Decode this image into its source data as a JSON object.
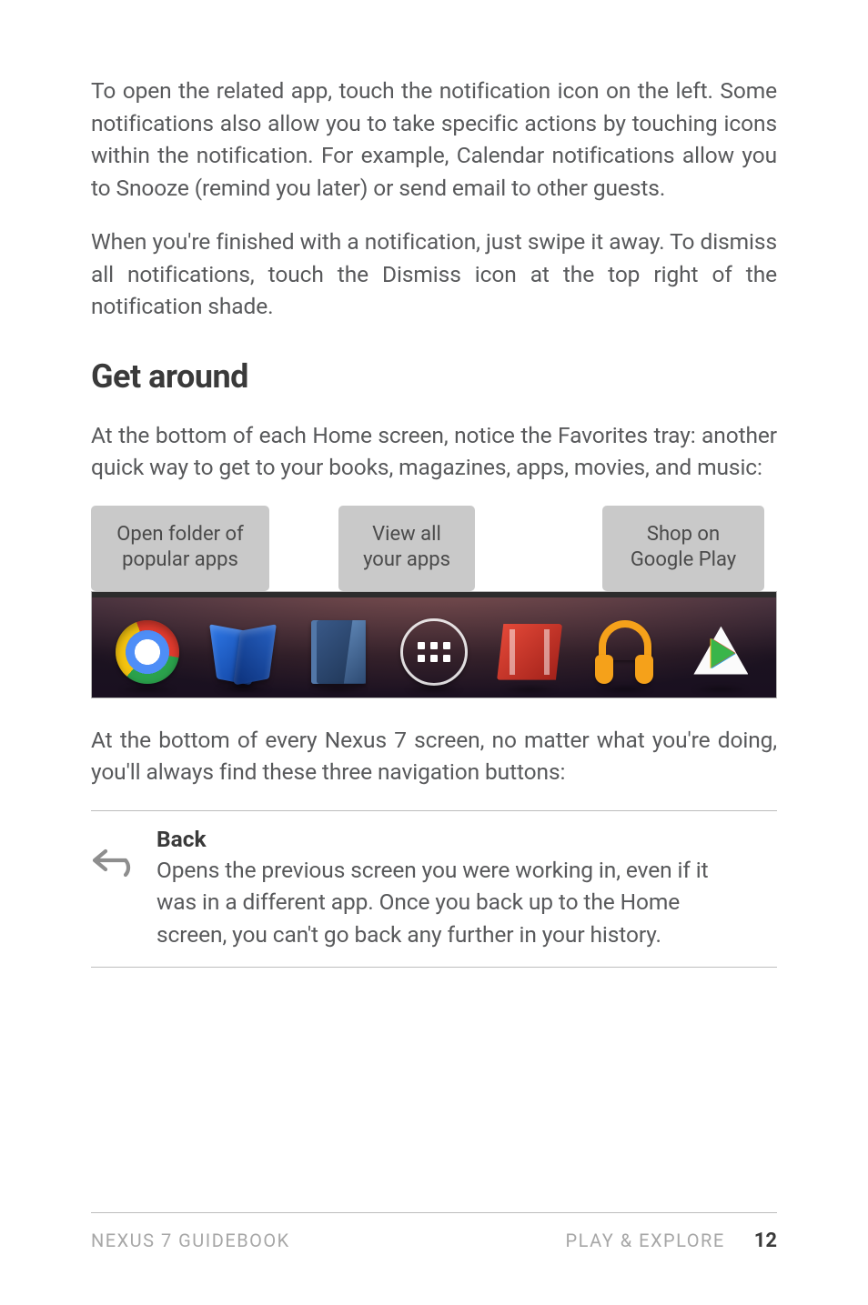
{
  "paragraphs": {
    "p1": "To open the related app, touch the notification icon on the left. Some notifications also allow you to take specific actions by touching icons within the notification. For example, Calendar notifications allow you to Snooze (remind you later) or send email to other guests.",
    "p2": "When you're finished with a notification, just swipe it away. To dismiss all notifications, touch the Dismiss icon at the top right of the notification shade.",
    "p3": "At the bottom of each Home screen, notice the Favorites tray: another quick way to get to your books, magazines, apps, movies, and music:",
    "p4": "At the bottom of every Nexus 7 screen, no matter what you're doing, you'll always find these three navigation buttons:"
  },
  "heading": "Get around",
  "callouts": {
    "c1_l1": "Open folder of",
    "c1_l2": "popular apps",
    "c2_l1": "View all",
    "c2_l2": "your apps",
    "c3_l1": "Shop on",
    "c3_l2": "Google Play"
  },
  "tray_icons": [
    "chrome",
    "play-books",
    "play-magazines",
    "all-apps",
    "play-movies",
    "play-music",
    "play-store"
  ],
  "nav": {
    "back": {
      "title": "Back",
      "body": "Opens the previous screen you were working in, even if it was in a different app. Once you back up to the Home screen, you can't go back any further in your history."
    }
  },
  "footer": {
    "left": "NEXUS 7 GUIDEBOOK",
    "right": "PLAY & EXPLORE",
    "page": "12"
  }
}
